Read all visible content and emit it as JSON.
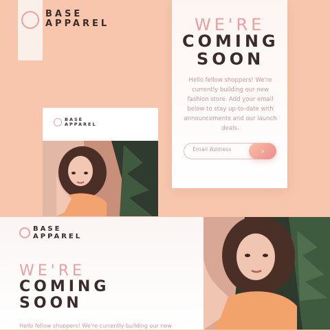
{
  "brand": {
    "line1": "BASE",
    "line2": "APPAREL"
  },
  "hero": {
    "line1": "WE'RE",
    "line2": "COMING",
    "line3": "SOON",
    "copy_lines": [
      "Hello fellow shoppers! We're",
      "currently building our new",
      "fashion store. Add your email",
      "below to stay up-to-date with",
      "announcements and our launch",
      "deals."
    ]
  },
  "form": {
    "email_placeholder": "Email Address",
    "submit_icon": "chevron-right-icon"
  },
  "bottom": {
    "copy": "Hello fellow shoppers! We're currently building our new"
  },
  "colors": {
    "accent": "#ec8d8f",
    "background": "#f7c6ad",
    "text_dark": "#3b2c2c",
    "text_light": "#e8a0a0"
  }
}
